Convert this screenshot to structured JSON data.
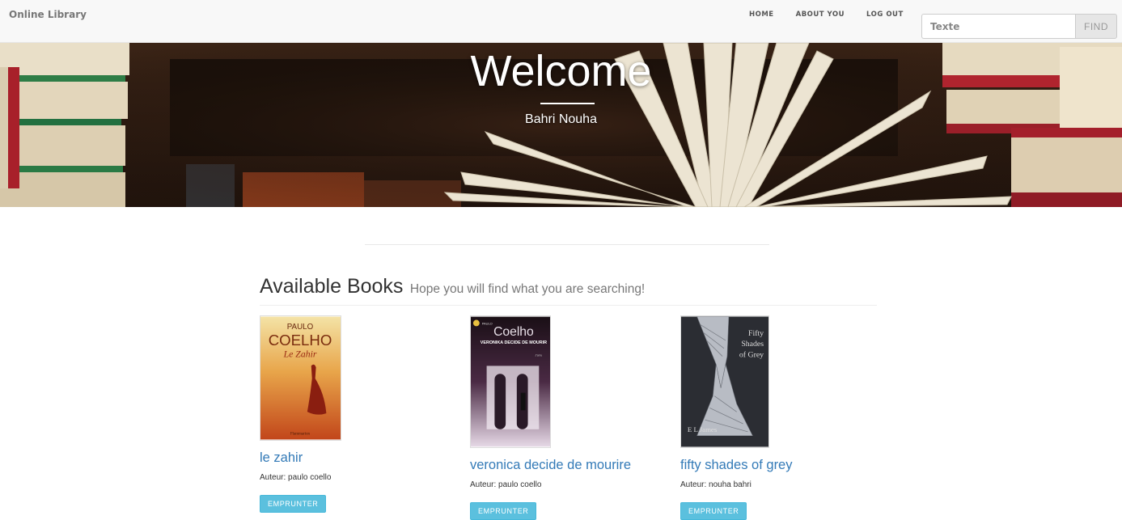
{
  "navbar": {
    "brand": "Online Library",
    "links": [
      "HOME",
      "ABOUT YOU",
      "LOG OUT"
    ],
    "search": {
      "placeholder": "Texte",
      "button": "FIND"
    }
  },
  "hero": {
    "title": "Welcome",
    "subtitle": "Bahri Nouha"
  },
  "section": {
    "title": "Available Books",
    "subtitle": "Hope you will find what you are searching!"
  },
  "books": [
    {
      "title": "le zahir",
      "author": "Auteur: paulo coello",
      "button": "EMPRUNTER",
      "cover": {
        "author_line": "PAULO",
        "publisher_line": "COELHO",
        "book_line": "Le Zahir",
        "footer": "Flammarion"
      }
    },
    {
      "title": "veronica decide de mourire",
      "author": "Auteur: paulo coello",
      "button": "EMPRUNTER",
      "cover": {
        "author_line": "PAULO",
        "publisher_line": "Coelho",
        "book_line": "VERONIKA DECIDE DE MOURIR",
        "footer": "J'ai lu"
      }
    },
    {
      "title": "fifty shades of grey",
      "author": "Auteur: nouha bahri",
      "button": "EMPRUNTER",
      "cover": {
        "author_line": "Fifty",
        "publisher_line": "Shades",
        "book_line": "of Grey",
        "footer": "E L James"
      }
    }
  ]
}
